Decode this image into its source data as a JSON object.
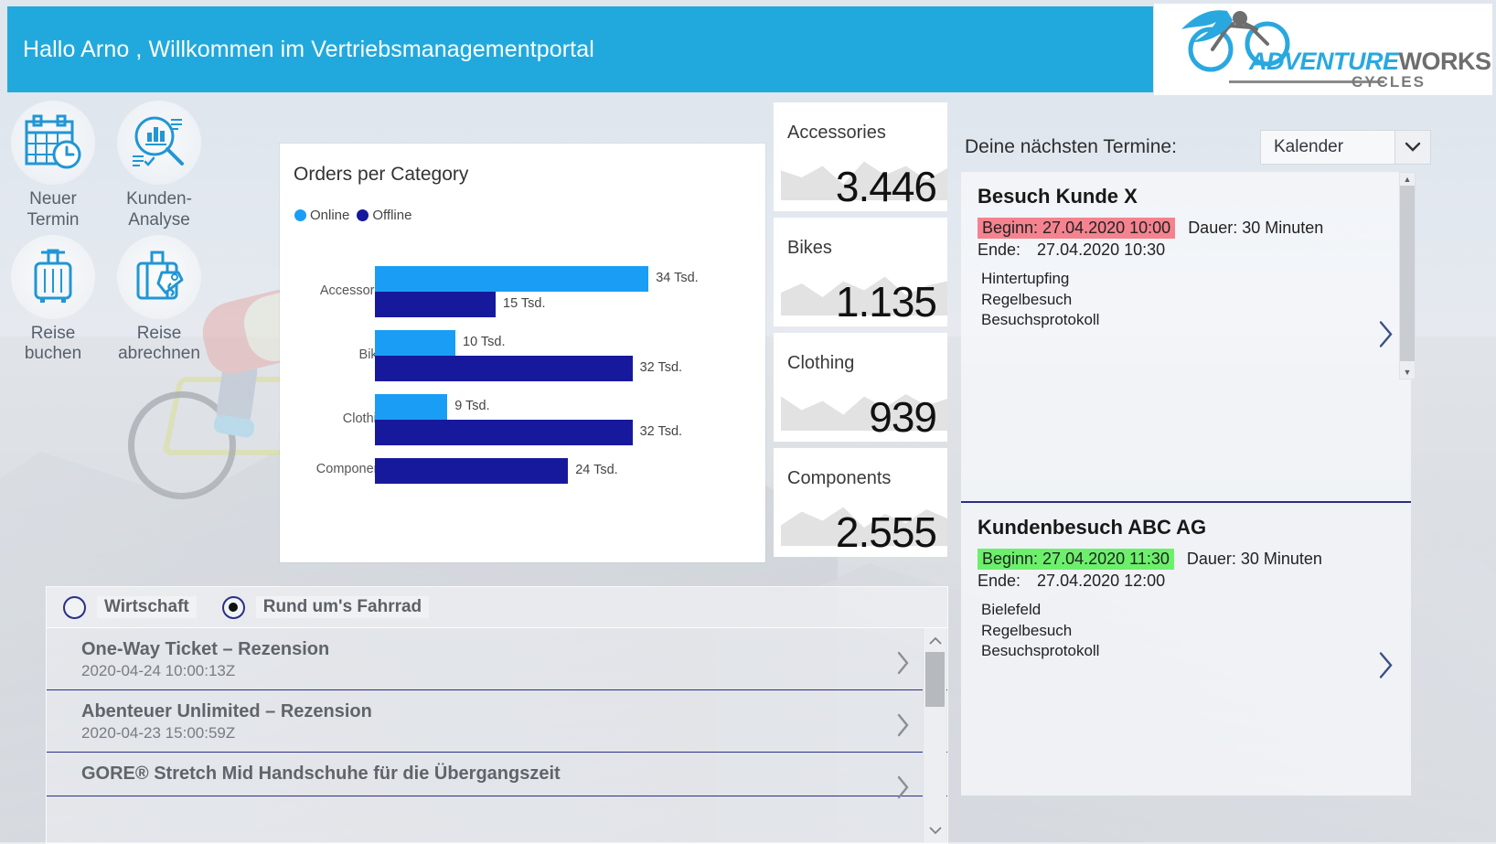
{
  "header": {
    "greeting": "Hallo Arno , Willkommen im Vertriebsmanagementportal",
    "logo": {
      "brand_part1": "ADVENTURE",
      "brand_part2": "WORKS",
      "sub": "CYCLES"
    },
    "accent_color": "#21a9dd"
  },
  "quick_actions": [
    {
      "label": "Neuer\nTermin",
      "label_line1": "Neuer",
      "label_line2": "Termin",
      "icon": "calendar-clock-icon"
    },
    {
      "label": "Kunden-\nAnalyse",
      "label_line1": "Kunden-",
      "label_line2": "Analyse",
      "icon": "magnifier-chart-icon"
    },
    {
      "label": "Reise\nbuchen",
      "label_line1": "Reise",
      "label_line2": "buchen",
      "icon": "suitcase-icon"
    },
    {
      "label": "Reise\nabrechnen",
      "label_line1": "Reise",
      "label_line2": "abrechnen",
      "icon": "suitcase-tag-icon"
    }
  ],
  "chart_data": {
    "type": "bar",
    "orientation": "horizontal",
    "title": "Orders per Category",
    "xlabel": "",
    "ylabel": "",
    "unit_suffix": "Tsd.",
    "grid": false,
    "legend_position": "top-left",
    "categories": [
      "Accessories",
      "Bikes",
      "Clothing",
      "Components"
    ],
    "series": [
      {
        "name": "Online",
        "color": "#1a9ef5",
        "values": [
          34,
          10,
          9,
          null
        ],
        "labels": [
          "34 Tsd.",
          "10 Tsd.",
          "9 Tsd.",
          ""
        ]
      },
      {
        "name": "Offline",
        "color": "#17199c",
        "values": [
          15,
          32,
          32,
          24
        ],
        "labels": [
          "15 Tsd.",
          "32 Tsd.",
          "32 Tsd.",
          "24 Tsd."
        ]
      }
    ],
    "xlim": [
      0,
      40
    ]
  },
  "kpis": [
    {
      "title": "Accessories",
      "value": "3.446",
      "spark": [
        26,
        20,
        30,
        14,
        34,
        22,
        30,
        18,
        28
      ]
    },
    {
      "title": "Bikes",
      "value": "1.135",
      "spark": [
        20,
        28,
        16,
        30,
        22,
        34,
        18,
        26,
        30
      ]
    },
    {
      "title": "Clothing",
      "value": "939",
      "spark": [
        30,
        18,
        26,
        14,
        30,
        20,
        32,
        22,
        28
      ]
    },
    {
      "title": "Components",
      "value": "2.555",
      "spark": [
        18,
        30,
        22,
        34,
        16,
        28,
        20,
        32,
        24
      ]
    }
  ],
  "calendar": {
    "heading": "Deine nächsten Termine:",
    "selector_value": "Kalender",
    "selector_icon": "chevron-down-icon",
    "appointments": [
      {
        "title": "Besuch Kunde X",
        "begin_label": "Beginn: 27.04.2020 10:00",
        "begin_highlight": "#f4838f",
        "duration_label": "Dauer: 30 Minuten",
        "end_label_key": "Ende:",
        "end_label_value": "27.04.2020 10:30",
        "meta": [
          "Hintertupfing",
          "Regelbesuch",
          "Besuchsprotokoll"
        ]
      },
      {
        "title": "Kundenbesuch ABC AG",
        "begin_label": "Beginn: 27.04.2020 11:30",
        "begin_highlight": "#6cf06c",
        "duration_label": "Dauer: 30 Minuten",
        "end_label_key": "Ende:",
        "end_label_value": "27.04.2020 12:00",
        "meta": [
          "Bielefeld",
          "Regelbesuch",
          "Besuchsprotokoll"
        ]
      }
    ]
  },
  "news": {
    "tabs": [
      {
        "label": "Wirtschaft",
        "selected": false
      },
      {
        "label": "Rund um's Fahrrad",
        "selected": true
      }
    ],
    "items": [
      {
        "title": "One-Way Ticket – Rezension",
        "date": "2020-04-24 10:00:13Z"
      },
      {
        "title": "Abenteuer Unlimited – Rezension",
        "date": "2020-04-23 15:00:59Z"
      },
      {
        "title": "GORE® Stretch Mid Handschuhe für die Übergangszeit",
        "date": ""
      }
    ]
  }
}
